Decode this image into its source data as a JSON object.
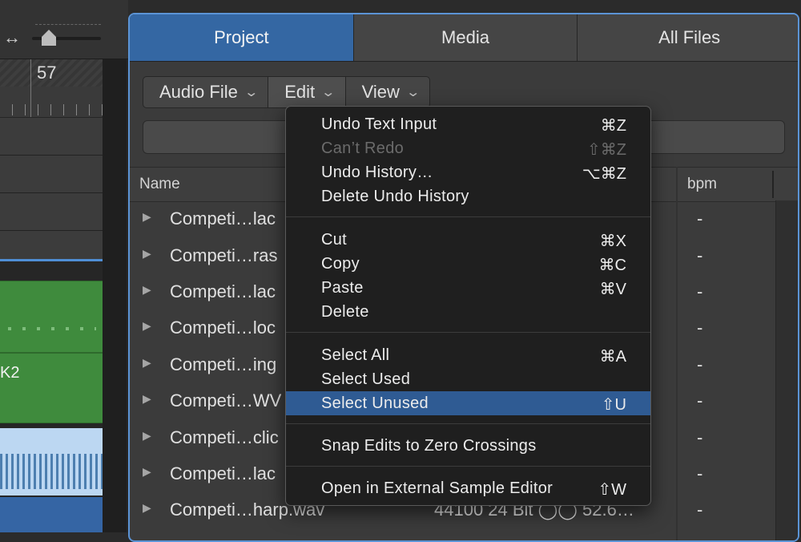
{
  "left_area": {
    "zoom_icon": "↔",
    "bar_number": "57",
    "region_label": "K2"
  },
  "browser": {
    "tabs": [
      "Project",
      "Media",
      "All Files"
    ],
    "active_tab": "Project",
    "toolbar": {
      "audio_file": "Audio File",
      "edit": "Edit",
      "view": "View"
    },
    "columns": {
      "name": "Name",
      "bpm": "bpm"
    },
    "rows": [
      {
        "name": "Competi…lac",
        "bpm": "-"
      },
      {
        "name": "Competi…ras",
        "bpm": "-"
      },
      {
        "name": "Competi…lac",
        "bpm": "-"
      },
      {
        "name": "Competi…loc",
        "bpm": "-"
      },
      {
        "name": "Competi…ing",
        "bpm": "-"
      },
      {
        "name": "Competi…WV",
        "bpm": "-"
      },
      {
        "name": "Competi…clic",
        "bpm": "-"
      },
      {
        "name": "Competi…lac",
        "bpm": "-"
      },
      {
        "name": "Competi…harp.wav",
        "bpm": "-",
        "details": "44100 24 Bit ◯◯ 52.6…"
      }
    ]
  },
  "edit_menu": {
    "items": [
      {
        "label": "Undo Text Input",
        "shortcut": "⌘Z",
        "enabled": true
      },
      {
        "label": "Can’t Redo",
        "shortcut": "⇧⌘Z",
        "enabled": false
      },
      {
        "label": "Undo History…",
        "shortcut": "⌥⌘Z",
        "enabled": true
      },
      {
        "label": "Delete Undo History",
        "shortcut": "",
        "enabled": true
      },
      {
        "label": "Cut",
        "shortcut": "⌘X",
        "enabled": true
      },
      {
        "label": "Copy",
        "shortcut": "⌘C",
        "enabled": true
      },
      {
        "label": "Paste",
        "shortcut": "⌘V",
        "enabled": true
      },
      {
        "label": "Delete",
        "shortcut": "",
        "enabled": true
      },
      {
        "label": "Select All",
        "shortcut": "⌘A",
        "enabled": true
      },
      {
        "label": "Select Used",
        "shortcut": "",
        "enabled": true
      },
      {
        "label": "Select Unused",
        "shortcut": "⇧U",
        "enabled": true,
        "highlighted": true
      },
      {
        "label": "Snap Edits to Zero Crossings",
        "shortcut": "",
        "enabled": true
      },
      {
        "label": "Open in External Sample Editor",
        "shortcut": "⇧W",
        "enabled": true
      }
    ]
  },
  "colors": {
    "accent": "#3467a3",
    "highlight": "#2f5b93",
    "region_green": "#3f8b3d",
    "focus_border": "#5b94d6"
  }
}
